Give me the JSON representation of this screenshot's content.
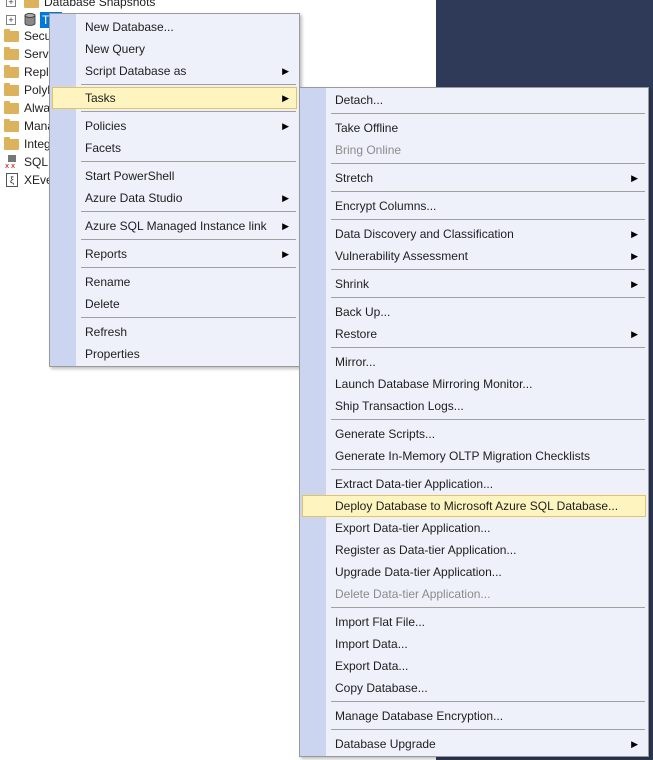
{
  "colors": {
    "background_panel": "#2e3a57",
    "menu_bg": "#eef0fa",
    "menu_gutter": "#ccd5f0",
    "highlight_bg": "#fdf4bf",
    "highlight_border": "#e5c365",
    "selection": "#0078d7",
    "folder": "#dcb35c"
  },
  "tree": {
    "snapshots": "Database Snapshots",
    "selected_db": "T",
    "items": [
      "Secu",
      "Serve",
      "Repli",
      "Polyl",
      "Alwa",
      "Mana",
      "Integ",
      "SQL",
      "XEve"
    ]
  },
  "context_menu": {
    "new_database": "New Database...",
    "new_query": "New Query",
    "script_database_as": "Script Database as",
    "tasks": "Tasks",
    "policies": "Policies",
    "facets": "Facets",
    "start_powershell": "Start PowerShell",
    "azure_data_studio": "Azure Data Studio",
    "azure_sql_mi_link": "Azure SQL Managed Instance link",
    "reports": "Reports",
    "rename": "Rename",
    "delete": "Delete",
    "refresh": "Refresh",
    "properties": "Properties"
  },
  "tasks_menu": {
    "detach": "Detach...",
    "take_offline": "Take Offline",
    "bring_online": "Bring Online",
    "stretch": "Stretch",
    "encrypt_columns": "Encrypt Columns...",
    "data_discovery": "Data Discovery and Classification",
    "vulnerability_assessment": "Vulnerability Assessment",
    "shrink": "Shrink",
    "back_up": "Back Up...",
    "restore": "Restore",
    "mirror": "Mirror...",
    "launch_mirroring_monitor": "Launch Database Mirroring Monitor...",
    "ship_transaction_logs": "Ship Transaction Logs...",
    "generate_scripts": "Generate Scripts...",
    "generate_inmemory_checklists": "Generate In-Memory OLTP Migration Checklists",
    "extract_data_tier": "Extract Data-tier Application...",
    "deploy_to_azure": "Deploy Database to Microsoft Azure SQL Database...",
    "export_data_tier": "Export Data-tier Application...",
    "register_data_tier": "Register as Data-tier Application...",
    "upgrade_data_tier": "Upgrade Data-tier Application...",
    "delete_data_tier": "Delete Data-tier Application...",
    "import_flat_file": "Import Flat File...",
    "import_data": "Import Data...",
    "export_data": "Export Data...",
    "copy_database": "Copy Database...",
    "manage_encryption": "Manage Database Encryption...",
    "database_upgrade": "Database Upgrade"
  }
}
